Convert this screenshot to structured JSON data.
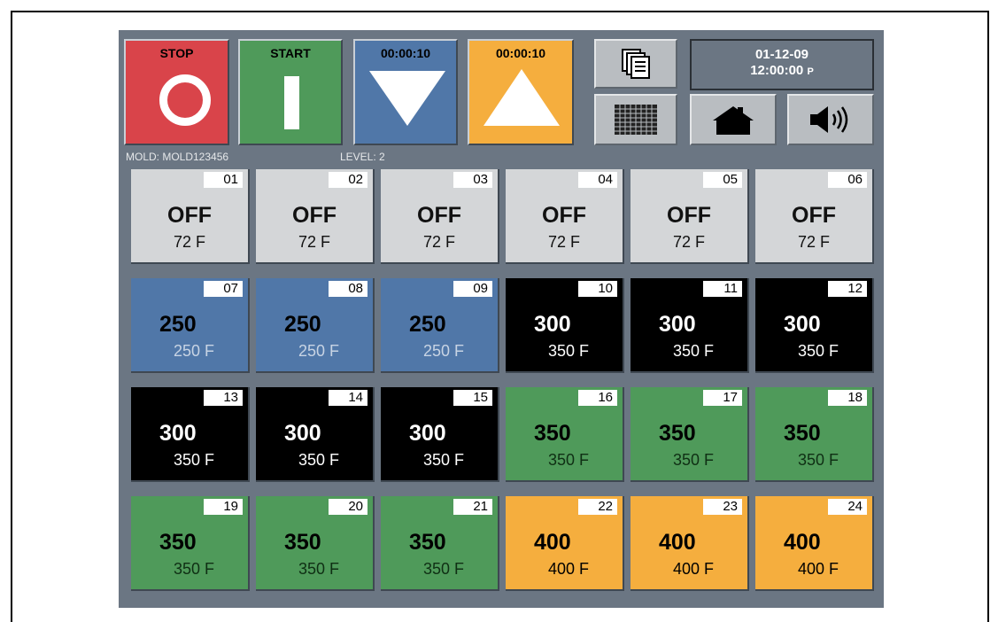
{
  "controls": {
    "stop_label": "STOP",
    "start_label": "START",
    "down_timer": "00:00:10",
    "up_timer": "00:00:10",
    "date": "01-12-09",
    "time": "12:00:00",
    "ampm": "P"
  },
  "status": {
    "mold": "MOLD: MOLD123456",
    "level": "LEVEL: 2"
  },
  "icons": {
    "copy": "copy-icon",
    "grid": "grid-icon",
    "home": "home-icon",
    "sound": "speaker-icon"
  },
  "colors": {
    "off": "#d4d6d8",
    "blue": "#5077a8",
    "black": "#000000",
    "green": "#4f9a5a",
    "orange": "#f5ae3e",
    "stop": "#d9444a"
  },
  "zones": [
    {
      "num": "01",
      "main": "OFF",
      "sub": "72 F",
      "state": "off"
    },
    {
      "num": "02",
      "main": "OFF",
      "sub": "72 F",
      "state": "off"
    },
    {
      "num": "03",
      "main": "OFF",
      "sub": "72 F",
      "state": "off"
    },
    {
      "num": "04",
      "main": "OFF",
      "sub": "72 F",
      "state": "off"
    },
    {
      "num": "05",
      "main": "OFF",
      "sub": "72 F",
      "state": "off"
    },
    {
      "num": "06",
      "main": "OFF",
      "sub": "72 F",
      "state": "off"
    },
    {
      "num": "07",
      "main": "250",
      "sub": "250 F",
      "state": "blue"
    },
    {
      "num": "08",
      "main": "250",
      "sub": "250 F",
      "state": "blue"
    },
    {
      "num": "09",
      "main": "250",
      "sub": "250 F",
      "state": "blue"
    },
    {
      "num": "10",
      "main": "300",
      "sub": "350 F",
      "state": "black"
    },
    {
      "num": "11",
      "main": "300",
      "sub": "350 F",
      "state": "black"
    },
    {
      "num": "12",
      "main": "300",
      "sub": "350 F",
      "state": "black"
    },
    {
      "num": "13",
      "main": "300",
      "sub": "350 F",
      "state": "black"
    },
    {
      "num": "14",
      "main": "300",
      "sub": "350 F",
      "state": "black"
    },
    {
      "num": "15",
      "main": "300",
      "sub": "350 F",
      "state": "black"
    },
    {
      "num": "16",
      "main": "350",
      "sub": "350 F",
      "state": "green"
    },
    {
      "num": "17",
      "main": "350",
      "sub": "350 F",
      "state": "green"
    },
    {
      "num": "18",
      "main": "350",
      "sub": "350 F",
      "state": "green"
    },
    {
      "num": "19",
      "main": "350",
      "sub": "350 F",
      "state": "green"
    },
    {
      "num": "20",
      "main": "350",
      "sub": "350 F",
      "state": "green"
    },
    {
      "num": "21",
      "main": "350",
      "sub": "350 F",
      "state": "green"
    },
    {
      "num": "22",
      "main": "400",
      "sub": "400 F",
      "state": "orange"
    },
    {
      "num": "23",
      "main": "400",
      "sub": "400 F",
      "state": "orange"
    },
    {
      "num": "24",
      "main": "400",
      "sub": "400 F",
      "state": "orange"
    }
  ]
}
